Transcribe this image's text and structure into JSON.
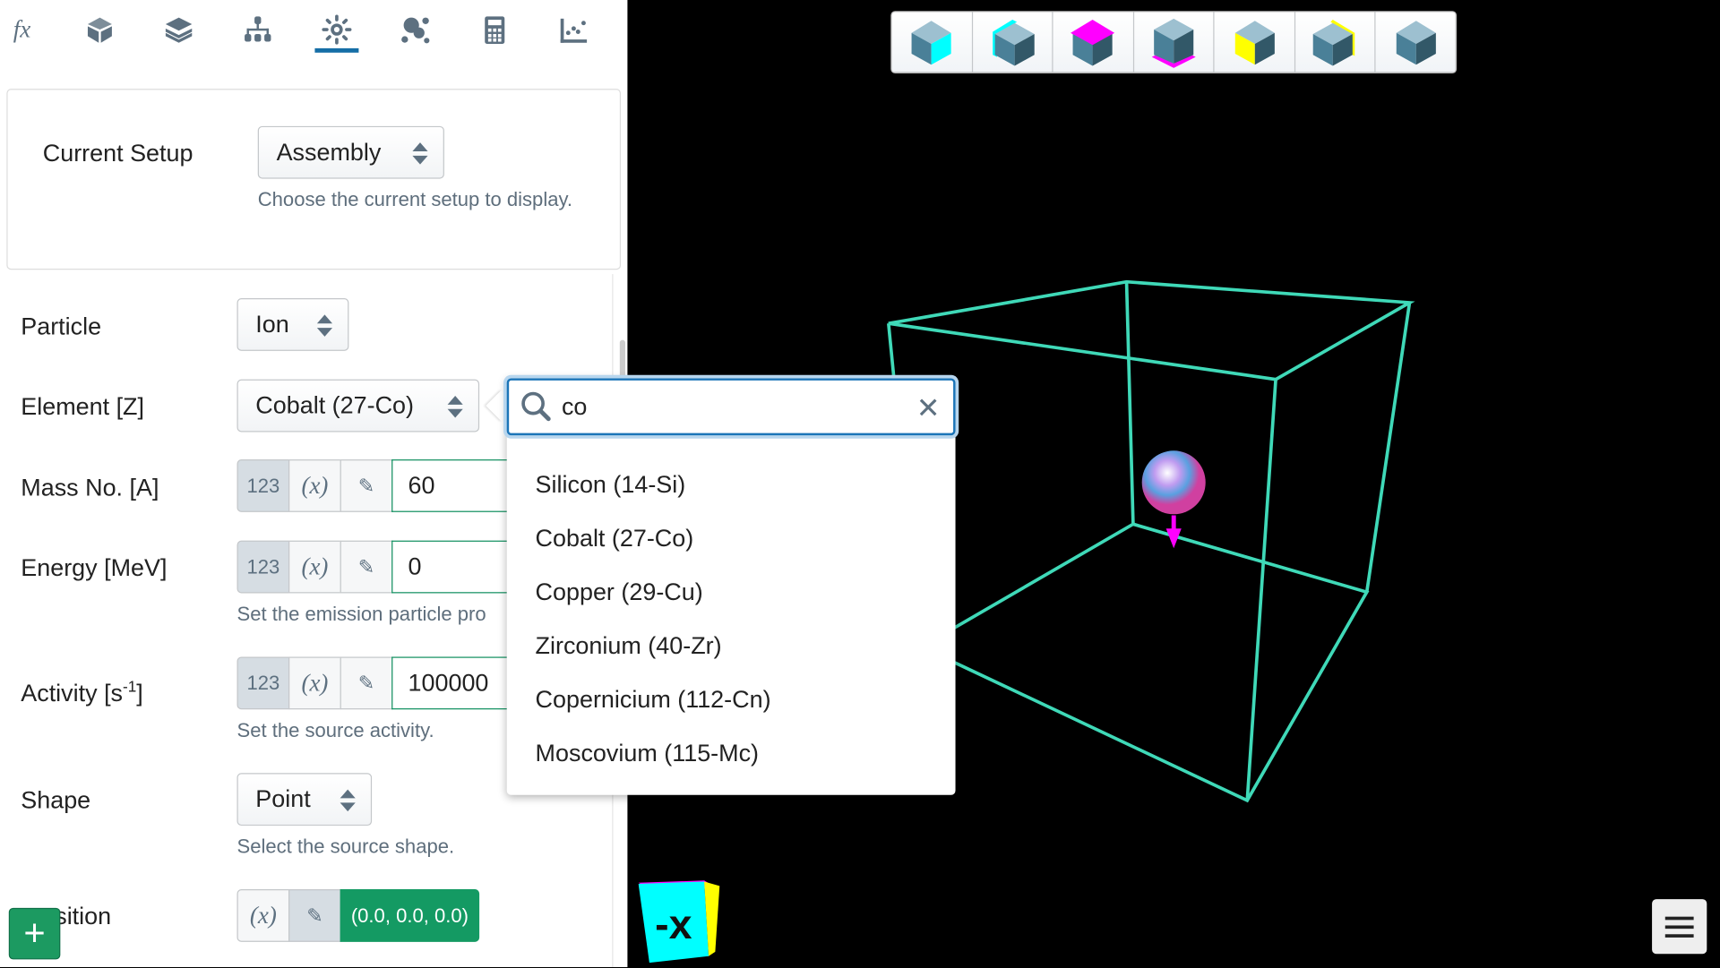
{
  "nav": {
    "items": [
      "formula-icon",
      "geometry-icon",
      "layers-icon",
      "hierarchy-icon",
      "source-icon",
      "particles-icon",
      "calculator-icon",
      "scatter-plot-icon"
    ],
    "active": 4,
    "fx_label": "fx"
  },
  "setup": {
    "label": "Current Setup",
    "value": "Assembly",
    "help": "Choose the current setup to display."
  },
  "particle": {
    "label": "Particle",
    "value": "Ion"
  },
  "element": {
    "label": "Element [Z]",
    "value": "Cobalt (27-Co)"
  },
  "mass": {
    "label": "Mass No. [A]",
    "value": "60",
    "btn_num": "123",
    "btn_var": "(x)"
  },
  "energy": {
    "label": "Energy [MeV]",
    "value": "0",
    "btn_num": "123",
    "btn_var": "(x)",
    "help": "Set the emission particle pro"
  },
  "activity": {
    "label_main": "Activity [s",
    "label_sup": "-1",
    "label_end": "]",
    "value": "100000",
    "btn_num": "123",
    "btn_var": "(x)",
    "help": "Set the source activity."
  },
  "shape": {
    "label": "Shape",
    "value": "Point",
    "help": "Select the source shape."
  },
  "position": {
    "label": "sition",
    "btn_var": "(x)",
    "value": "(0.0, 0.0, 0.0)"
  },
  "add_button": "+",
  "search": {
    "query": "co",
    "options": [
      "Silicon (14-Si)",
      "Cobalt (27-Co)",
      "Copper (29-Cu)",
      "Zirconium (40-Zr)",
      "Copernicium (112-Cn)",
      "Moscovium (115-Mc)"
    ]
  },
  "view_buttons": [
    "view-plus-x",
    "view-minus-x",
    "view-plus-y",
    "view-minus-y",
    "view-plus-z",
    "view-minus-z",
    "view-iso"
  ],
  "orientation_cube_label": "-x",
  "colors": {
    "wireframe": "#3fd9b8",
    "accent": "#156ea6",
    "green": "#149a63",
    "magenta": "#ff00ff",
    "cyan": "#00ffff",
    "yellow": "#ffff00"
  }
}
